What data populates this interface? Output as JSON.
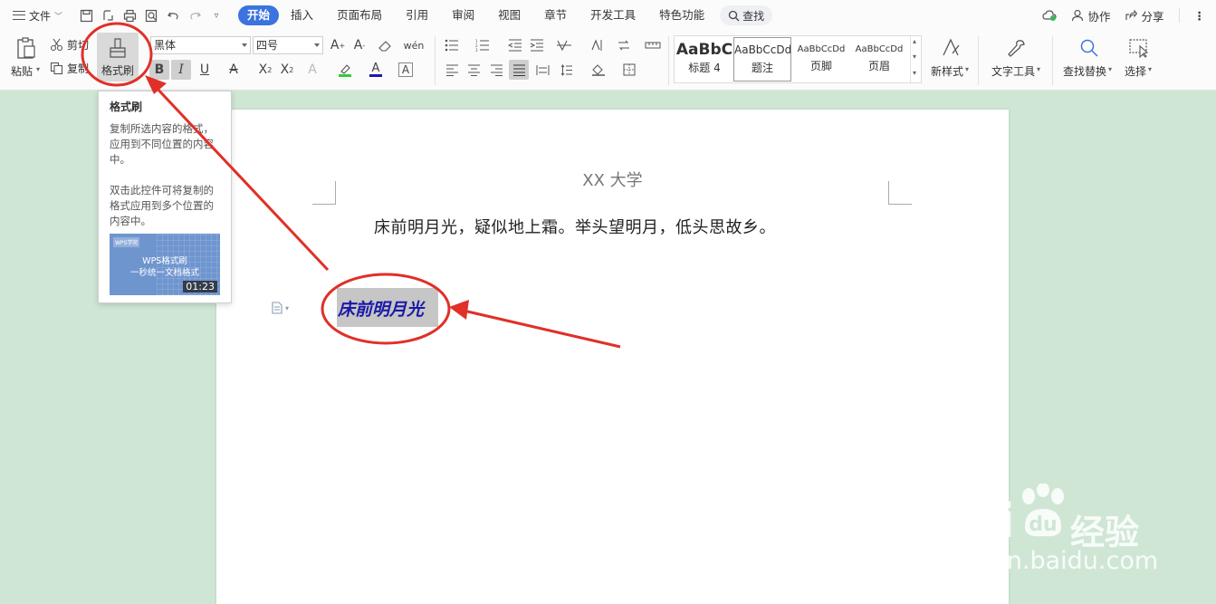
{
  "menubar": {
    "file_label": "文件",
    "tabs": [
      "开始",
      "插入",
      "页面布局",
      "引用",
      "审阅",
      "视图",
      "章节",
      "开发工具",
      "特色功能"
    ],
    "search_label": "查找",
    "right": {
      "cowork": "协作",
      "share": "分享"
    }
  },
  "ribbon": {
    "paste": "粘贴",
    "cut": "剪切",
    "copy": "复制",
    "format_painter": "格式刷",
    "font_name": "黑体",
    "font_size": "四号",
    "styles": [
      {
        "preview": "AaBbC",
        "name": "标题 4"
      },
      {
        "preview": "AaBbCcDd",
        "name": "题注"
      },
      {
        "preview": "AaBbCcDd",
        "name": "页脚"
      },
      {
        "preview": "AaBbCcDd",
        "name": "页眉"
      }
    ],
    "new_style": "新样式",
    "text_tools": "文字工具",
    "find_replace": "查找替换",
    "select": "选择"
  },
  "tooltip": {
    "title": "格式刷",
    "desc1": "复制所选内容的格式，应用到不同位置的内容中。",
    "desc2": "双击此控件可将复制的格式应用到多个位置的内容中。",
    "video_logo": "WPS学院",
    "video_title1": "WPS格式刷",
    "video_title2": "一秒统一文档格式",
    "video_duration": "01:23"
  },
  "document": {
    "header": "XX 大学",
    "line1": "床前明月光，疑似地上霜。举头望明月，低头思故乡。",
    "selected_text": "床前明月光"
  },
  "watermark": {
    "brand": "Bai",
    "brand_tail": "经验",
    "url": "jingyan.baidu.com"
  },
  "colors": {
    "accent": "#3b73e0",
    "annotation_red": "#e03027",
    "selected_text": "#1a1aa8",
    "background": "#cfe6d5"
  }
}
